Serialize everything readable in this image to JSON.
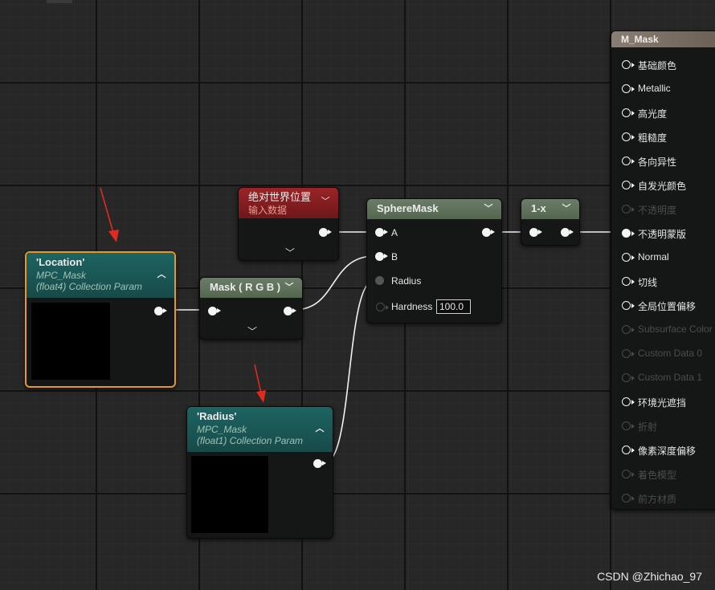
{
  "colors": {
    "teal_header": "#1a5a59",
    "red_header": "#8a1e22",
    "green_header": "#5f735e",
    "selection": "#e49a1e",
    "result_header": "#7c6f63",
    "annotation_arrow": "#e02a20"
  },
  "location_node": {
    "title": "'Location'",
    "sub1": "MPC_Mask",
    "sub2": "(float4) Collection Param"
  },
  "radius_node": {
    "title": "'Radius'",
    "sub1": "MPC_Mask",
    "sub2": "(float1) Collection Param"
  },
  "mask_node": {
    "title": "Mask ( R G B )"
  },
  "world_pos_node": {
    "title": "绝对世界位置",
    "subtitle": "输入数据"
  },
  "spheremask_node": {
    "title": "SphereMask",
    "pins": {
      "a": "A",
      "b": "B",
      "radius": "Radius",
      "hardness": "Hardness"
    },
    "hardness_value": "100.0"
  },
  "oneminus_node": {
    "title": "1-x"
  },
  "result_node": {
    "title": "M_Mask",
    "pins": [
      {
        "label": "基础颜色",
        "enabled": true
      },
      {
        "label": "Metallic",
        "enabled": true
      },
      {
        "label": "高光度",
        "enabled": true
      },
      {
        "label": "粗糙度",
        "enabled": true
      },
      {
        "label": "各向异性",
        "enabled": true
      },
      {
        "label": "自发光颜色",
        "enabled": true
      },
      {
        "label": "不透明度",
        "enabled": false
      },
      {
        "label": "不透明蒙版",
        "enabled": true
      },
      {
        "label": "Normal",
        "enabled": true
      },
      {
        "label": "切线",
        "enabled": true
      },
      {
        "label": "全局位置偏移",
        "enabled": true
      },
      {
        "label": "Subsurface Color",
        "enabled": false
      },
      {
        "label": "Custom Data 0",
        "enabled": false
      },
      {
        "label": "Custom Data 1",
        "enabled": false
      },
      {
        "label": "环境光遮挡",
        "enabled": true
      },
      {
        "label": "折射",
        "enabled": false
      },
      {
        "label": "像素深度偏移",
        "enabled": true
      },
      {
        "label": "着色模型",
        "enabled": false
      },
      {
        "label": "前方材质",
        "enabled": false
      }
    ]
  },
  "watermark": "CSDN @Zhichao_97"
}
